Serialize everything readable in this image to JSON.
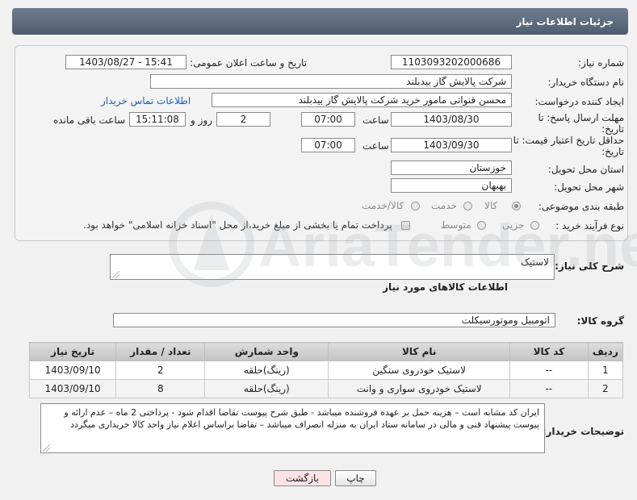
{
  "header": {
    "title": "جزئیات اطلاعات نیاز"
  },
  "form": {
    "need_number_label": "شماره نیاز:",
    "need_number": "1103093202000686",
    "announce_label": "تاریخ و ساعت اعلان عمومی:",
    "announce_value": "1403/08/27 - 15:41",
    "buyer_org_label": "نام دستگاه خریدار:",
    "buyer_org": "شرکت پالایش گاز بیدبلند",
    "creator_label": "ایجاد کننده درخواست:",
    "creator": "محسن قنواتی مامور خرید شرکت پالایش گاز بیدبلند",
    "contact_link": "اطلاعات تماس خریدار",
    "deadline_label_1": "مهلت ارسال پاسخ: تا",
    "deadline_label_2": "تاریخ:",
    "deadline_date": "1403/08/30",
    "time_label": "ساعت",
    "deadline_time": "07:00",
    "days_value": "2",
    "days_label": "روز و",
    "remaining_time": "15:11:08",
    "remaining_label": "ساعت باقی مانده",
    "validity_label_1": "حداقل تاریخ اعتبار قیمت: تا",
    "validity_label_2": "تاریخ:",
    "validity_date": "1403/09/30",
    "validity_time": "07:00",
    "province_label": "استان محل تحویل:",
    "province": "خوزستان",
    "city_label": "شهر محل تحویل:",
    "city": "بهبهان",
    "category_label": "طبقه بندی موضوعی:",
    "category_options": [
      "کالا",
      "خدمت",
      "کالا/خدمت"
    ],
    "purchase_type_label": "نوع فرآیند خرید :",
    "purchase_options": [
      "جزیی",
      "متوسط"
    ],
    "payment_note": "پرداخت تمام یا بخشی از مبلغ خرید،از محل \"اسناد خزانه اسلامی\" خواهد بود."
  },
  "description": {
    "label": "شرح کلی نیاز:",
    "value": "لاستیک"
  },
  "items_section": {
    "title": "اطلاعات کالاهای مورد نیاز",
    "group_label": "گروه کالا:",
    "group_value": "اتومبیل وموتورسیکلت"
  },
  "table": {
    "headers": [
      "ردیف",
      "کد کالا",
      "نام کالا",
      "واحد شمارش",
      "تعداد / مقدار",
      "تاریخ نیاز"
    ],
    "rows": [
      [
        "1",
        "--",
        "لاستیک خودروی سنگین",
        "(رینگ)حلقه",
        "2",
        "1403/09/10"
      ],
      [
        "2",
        "--",
        "لاستیک خودروی سواری و وانت",
        "(رینگ)حلقه",
        "8",
        "1403/09/10"
      ]
    ]
  },
  "buyer_notes": {
    "label": "توضیحات خریدار:",
    "text": "ایران کد مشابه است – هزینه حمل بر عهده فروشنده میباشد - طبق شرح پیوست تقاضا اقدام شود - پرداختی 2 ماه – عدم ارائه و پیوست پیشنهاد فنی و مالی در سامانه ستاد ایران به منزله انصراف میباشد – تقاضا براساس اعلام نیاز واحد کالا خریداری میگردد"
  },
  "buttons": {
    "print": "چاپ",
    "back": "بازگشت"
  },
  "watermark": {
    "text": "AriaTender.neT"
  },
  "colors": {
    "header": "#5d6c7f",
    "link": "#1d5fb8",
    "back_button_bg": "#fbe3e3"
  }
}
